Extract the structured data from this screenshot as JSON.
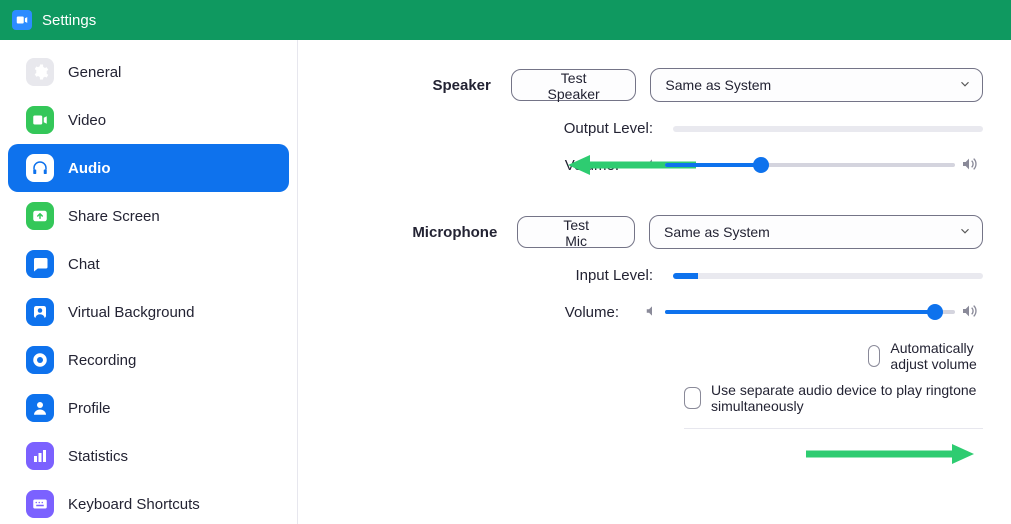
{
  "window": {
    "title": "Settings"
  },
  "sidebar": {
    "items": [
      {
        "label": "General"
      },
      {
        "label": "Video"
      },
      {
        "label": "Audio"
      },
      {
        "label": "Share Screen"
      },
      {
        "label": "Chat"
      },
      {
        "label": "Virtual Background"
      },
      {
        "label": "Recording"
      },
      {
        "label": "Profile"
      },
      {
        "label": "Statistics"
      },
      {
        "label": "Keyboard Shortcuts"
      }
    ],
    "activeIndex": 2
  },
  "audio": {
    "speaker": {
      "header": "Speaker",
      "testButton": "Test Speaker",
      "device": "Same as System",
      "outputLabel": "Output Level:",
      "volumeLabel": "Volume:",
      "outputLevelPercent": 0,
      "volumePercent": 33
    },
    "microphone": {
      "header": "Microphone",
      "testButton": "Test Mic",
      "device": "Same as System",
      "inputLabel": "Input Level:",
      "volumeLabel": "Volume:",
      "inputLevelPercent": 8,
      "volumePercent": 93,
      "autoAdjustLabel": "Automatically adjust volume",
      "autoAdjustChecked": false
    },
    "separateRingtone": {
      "label": "Use separate audio device to play ringtone simultaneously",
      "checked": false
    }
  },
  "colors": {
    "iconMuted": "#d8dbe0",
    "iconGreen": "#34c759",
    "iconBlue": "#0e72ed",
    "iconPurple": "#7b61ff"
  }
}
